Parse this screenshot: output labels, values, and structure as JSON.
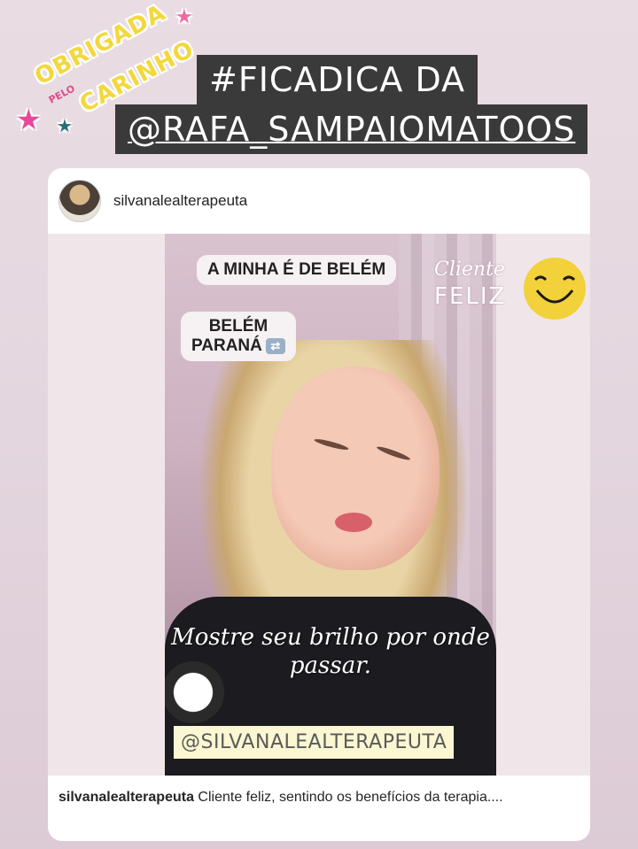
{
  "sticker": {
    "line1": "OBRIGADA",
    "line2": "PELO",
    "line3": "CARINHO"
  },
  "header": {
    "line1": "#FICADICA DA",
    "line2": "@RAFA_SAMPAIOMATOOS"
  },
  "post": {
    "username": "silvanalealterapeuta",
    "chip1": "A MINHA É DE BELÉM",
    "chip2_line1": "BELÉM",
    "chip2_line2": "PARANÁ",
    "happy_line1": "Cliente",
    "happy_line2": "FELIZ",
    "script_text": "Mostre seu brilho por onde passar.",
    "handle_tag": "@SILVANALEALTERAPEUTA",
    "caption_user": "silvanalealterapeuta",
    "caption_text": " Cliente feliz, sentindo os benefícios da terapia...."
  },
  "colors": {
    "background": "#e6d8df",
    "header_box": "#3a3a3a",
    "sticker_yellow": "#f3d83d",
    "sticker_pink": "#e8489a",
    "smiley_yellow": "#f2d13a"
  }
}
